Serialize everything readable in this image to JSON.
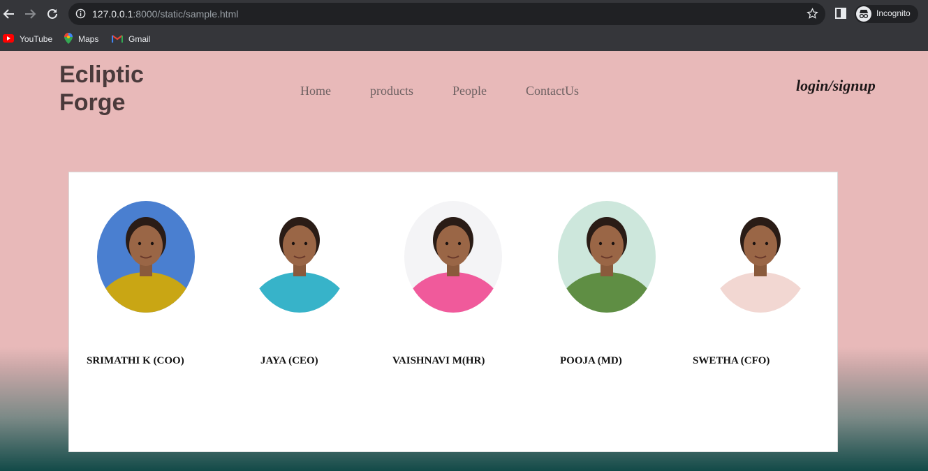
{
  "browser": {
    "url_host": "127.0.0.1",
    "url_rest": ":8000/static/sample.html",
    "incognito_label": "Incognito",
    "bookmarks": [
      {
        "label": "YouTube",
        "icon": "youtube-icon"
      },
      {
        "label": "Maps",
        "icon": "maps-icon"
      },
      {
        "label": "Gmail",
        "icon": "gmail-icon"
      }
    ]
  },
  "site": {
    "brand_line1": "Ecliptic",
    "brand_line2": "Forge",
    "nav": [
      "Home",
      "products",
      "People",
      "ContactUs"
    ],
    "login": "login/signup"
  },
  "people": [
    {
      "name": "SRIMATHI K (COO)",
      "bg": "#4a7fd0",
      "top": "#c9a614"
    },
    {
      "name": "JAYA (CEO)",
      "bg": "#ffffff",
      "top": "#37b3c9"
    },
    {
      "name": "VAISHNAVI M(HR)",
      "bg": "#f4f4f6",
      "top": "#f05a9b"
    },
    {
      "name": "POOJA (MD)",
      "bg": "#cde7dc",
      "top": "#5f8e44"
    },
    {
      "name": "SWETHA (CFO)",
      "bg": "#ffffff",
      "top": "#f2d7d2"
    }
  ]
}
